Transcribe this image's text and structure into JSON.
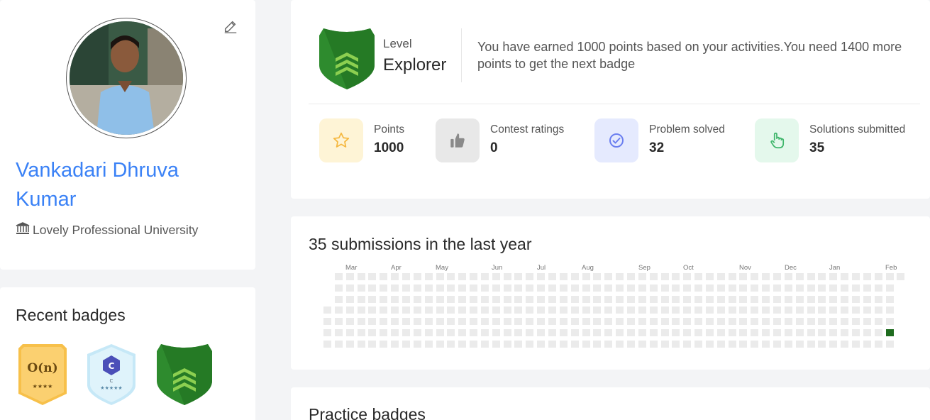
{
  "profile": {
    "name": "Vankadari Dhruva Kumar",
    "university": "Lovely Professional University",
    "edit_icon": "pencil-icon",
    "university_icon": "institution-icon"
  },
  "recent_badges": {
    "title": "Recent badges",
    "items": [
      {
        "name": "complexity-badge",
        "text": "O(n)",
        "stars": "★★★★",
        "color": "#f7c04a"
      },
      {
        "name": "c-language-badge",
        "text": "C",
        "sublabel": "C",
        "stars": "★★★★★",
        "color": "#d4eefa"
      },
      {
        "name": "explorer-badge",
        "color": "#2e8b2e"
      }
    ]
  },
  "level": {
    "label": "Level",
    "name": "Explorer",
    "message": "You have earned 1000 points based on your activities.You need 1400 more points to get the next badge",
    "shield_color": "#2e8b2e"
  },
  "stats": [
    {
      "key": "points",
      "label": "Points",
      "value": "1000",
      "icon": "star-icon",
      "bg": "#fef4d6",
      "fg": "#f5b840"
    },
    {
      "key": "contest",
      "label": "Contest ratings",
      "value": "0",
      "icon": "thumbs-up-icon",
      "bg": "#e8e8e8",
      "fg": "#8a8a8a"
    },
    {
      "key": "problems",
      "label": "Problem solved",
      "value": "32",
      "icon": "check-circle-icon",
      "bg": "#e5eafe",
      "fg": "#6b7ff0"
    },
    {
      "key": "solutions",
      "label": "Solutions submitted",
      "value": "35",
      "icon": "pointer-hand-icon",
      "bg": "#e4f8ec",
      "fg": "#3fb66b"
    }
  ],
  "submissions": {
    "title": "35 submissions in the last year",
    "months": [
      "Mar",
      "Apr",
      "May",
      "Jun",
      "Jul",
      "Aug",
      "Sep",
      "Oct",
      "Nov",
      "Dec",
      "Jan",
      "Feb"
    ],
    "active_color": "#1e6b1e",
    "empty_color": "#ebebeb"
  },
  "practice_badges": {
    "title": "Practice badges"
  }
}
